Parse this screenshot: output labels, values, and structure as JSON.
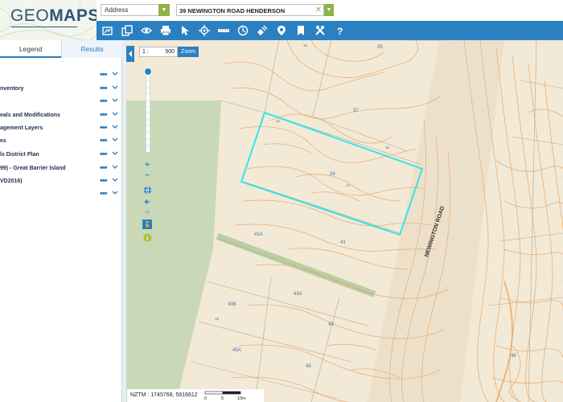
{
  "header": {
    "logo_text_light": "GEO",
    "logo_text_bold": "MAPS",
    "search_type": "Address",
    "search_value": "39 NEWINGTON ROAD HENDERSON"
  },
  "toolbar": {
    "tools": [
      "layers-icon",
      "copy-icon",
      "eye-icon",
      "print-icon",
      "pointer-icon",
      "locate-icon",
      "measure-icon",
      "history-icon",
      "satellite-icon",
      "street-view-icon",
      "bookmark-icon",
      "tools-icon",
      "help-icon"
    ],
    "accent_color": "#2b80c2"
  },
  "panel": {
    "tabs": [
      "Legend",
      "Results"
    ],
    "layers": [
      "nventory",
      "eals and Modifications",
      "agement Layers",
      "es",
      "ls District Plan",
      "99) - Great Barrier Island",
      "VD2016)"
    ],
    "dots": "•••"
  },
  "map_controls": {
    "scale_prefix": "1 :",
    "scale_value": "500",
    "zoom_label": "Zoom",
    "coords_label": "NZTM : 1745768, 5916612",
    "scale_bar_labels": [
      "0",
      "5",
      "10m"
    ]
  },
  "map": {
    "road_name": "NEWINGTON ROAD",
    "parcel_labels": [
      "35",
      "37",
      "39",
      "41",
      "41A",
      "43",
      "43A",
      "43B",
      "45",
      "45A",
      "46",
      "12",
      "14",
      "16",
      "18",
      "18"
    ],
    "highlight_color": "#33e6e6",
    "contour_color": "#e8b073",
    "park_color": "#c9d9b7"
  }
}
